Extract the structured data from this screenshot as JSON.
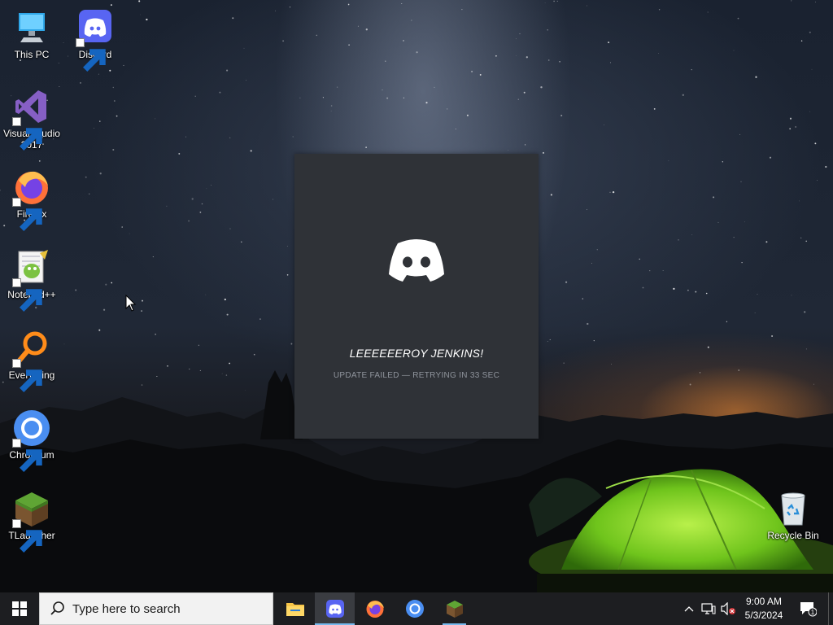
{
  "desktop": {
    "icons": [
      {
        "label": "This PC",
        "icon": "this-pc-icon"
      },
      {
        "label": "Discord",
        "icon": "discord-icon"
      },
      {
        "label": "Visual Studio 2017",
        "icon": "visual-studio-icon"
      },
      {
        "label": "Firefox",
        "icon": "firefox-icon"
      },
      {
        "label": "Notepad++",
        "icon": "notepadpp-icon"
      },
      {
        "label": "Everything",
        "icon": "everything-icon"
      },
      {
        "label": "Chromium",
        "icon": "chromium-icon"
      },
      {
        "label": "TLauncher",
        "icon": "tlauncher-icon"
      },
      {
        "label": "Recycle Bin",
        "icon": "recycle-bin-icon"
      }
    ]
  },
  "splash": {
    "app": "Discord",
    "title": "LEEEEEEROY JENKINS!",
    "status": "UPDATE FAILED — RETRYING IN 33 SEC",
    "background": "#2f3237"
  },
  "taskbar": {
    "search_placeholder": "Type here to search",
    "apps": [
      {
        "name": "File Explorer",
        "icon": "folder-icon",
        "active": false
      },
      {
        "name": "Discord",
        "icon": "discord-icon",
        "active": true
      },
      {
        "name": "Firefox",
        "icon": "firefox-icon",
        "active": false
      },
      {
        "name": "Chromium",
        "icon": "chromium-icon",
        "active": false
      },
      {
        "name": "TLauncher",
        "icon": "tlauncher-icon",
        "active": false
      }
    ],
    "clock": {
      "time": "9:00 AM",
      "date": "5/3/2024"
    },
    "notification_count": "1"
  },
  "colors": {
    "taskbar": "#1d1e21",
    "accent": "#76b9ed",
    "discord": "#5865f2"
  }
}
